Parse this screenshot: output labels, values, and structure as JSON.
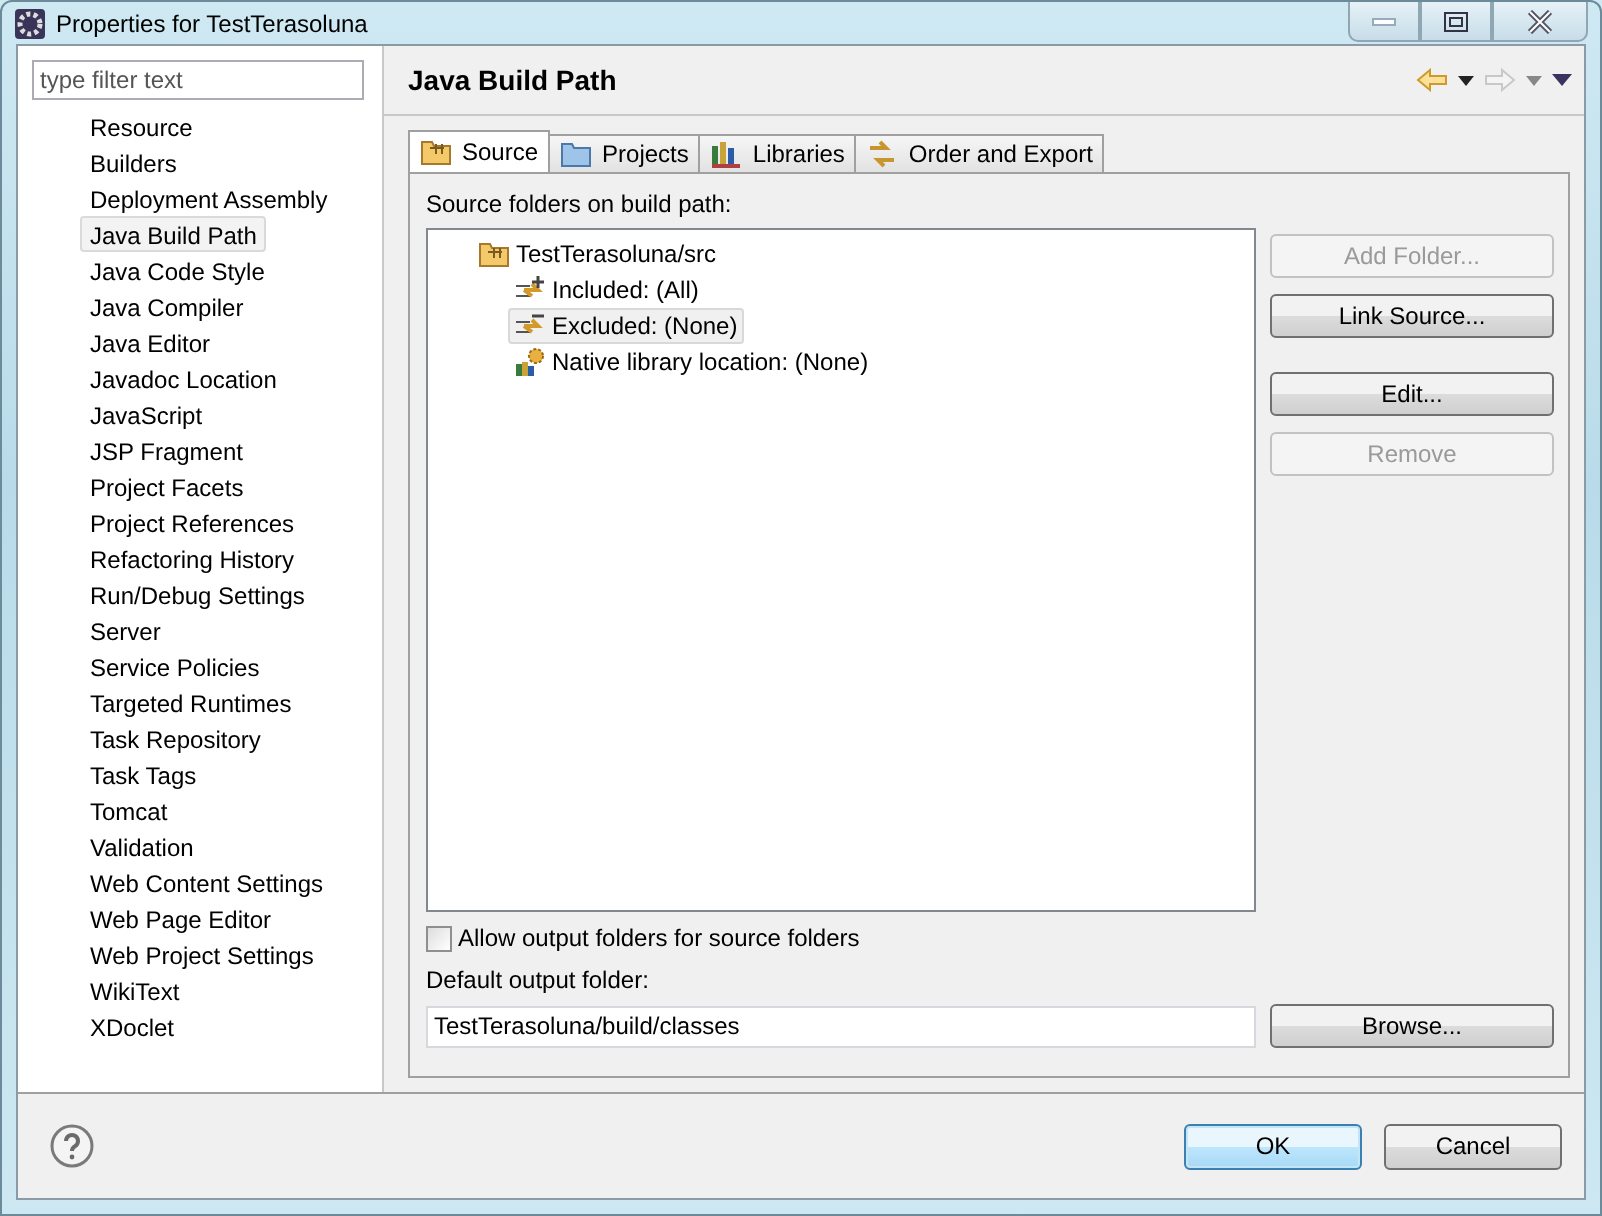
{
  "window": {
    "title": "Properties for TestTerasoluna"
  },
  "filter": {
    "placeholder": "type filter text"
  },
  "sidebar": {
    "items": [
      {
        "label": "Resource",
        "selected": false
      },
      {
        "label": "Builders",
        "selected": false
      },
      {
        "label": "Deployment Assembly",
        "selected": false
      },
      {
        "label": "Java Build Path",
        "selected": true
      },
      {
        "label": "Java Code Style",
        "selected": false
      },
      {
        "label": "Java Compiler",
        "selected": false
      },
      {
        "label": "Java Editor",
        "selected": false
      },
      {
        "label": "Javadoc Location",
        "selected": false
      },
      {
        "label": "JavaScript",
        "selected": false
      },
      {
        "label": "JSP Fragment",
        "selected": false
      },
      {
        "label": "Project Facets",
        "selected": false
      },
      {
        "label": "Project References",
        "selected": false
      },
      {
        "label": "Refactoring History",
        "selected": false
      },
      {
        "label": "Run/Debug Settings",
        "selected": false
      },
      {
        "label": "Server",
        "selected": false
      },
      {
        "label": "Service Policies",
        "selected": false
      },
      {
        "label": "Targeted Runtimes",
        "selected": false
      },
      {
        "label": "Task Repository",
        "selected": false
      },
      {
        "label": "Task Tags",
        "selected": false
      },
      {
        "label": "Tomcat",
        "selected": false
      },
      {
        "label": "Validation",
        "selected": false
      },
      {
        "label": "Web Content Settings",
        "selected": false
      },
      {
        "label": "Web Page Editor",
        "selected": false
      },
      {
        "label": "Web Project Settings",
        "selected": false
      },
      {
        "label": "WikiText",
        "selected": false
      },
      {
        "label": "XDoclet",
        "selected": false
      }
    ]
  },
  "page": {
    "title": "Java Build Path"
  },
  "tabs": [
    {
      "label": "Source",
      "selected": true
    },
    {
      "label": "Projects",
      "selected": false
    },
    {
      "label": "Libraries",
      "selected": false
    },
    {
      "label": "Order and Export",
      "selected": false
    }
  ],
  "source_label": "Source folders on build path:",
  "tree": [
    {
      "label": "TestTerasoluna/src",
      "kind": "folder",
      "selected": false,
      "children": [
        {
          "label": "Included: (All)",
          "kind": "included",
          "selected": false
        },
        {
          "label": "Excluded: (None)",
          "kind": "excluded",
          "selected": true
        },
        {
          "label": "Native library location: (None)",
          "kind": "native",
          "selected": false
        }
      ]
    }
  ],
  "side_buttons": [
    {
      "label": "Add Folder...",
      "disabled": true
    },
    {
      "label": "Link Source...",
      "disabled": false
    },
    {
      "label": "Edit...",
      "disabled": false
    },
    {
      "label": "Remove",
      "disabled": true
    }
  ],
  "allow_output": {
    "label": "Allow output folders for source folders",
    "checked": false
  },
  "output_folder": {
    "label": "Default output folder:",
    "value": "TestTerasoluna/build/classes",
    "button": "Browse..."
  },
  "buttons": [
    {
      "label": "OK",
      "default": true
    },
    {
      "label": "Cancel",
      "default": false
    }
  ]
}
